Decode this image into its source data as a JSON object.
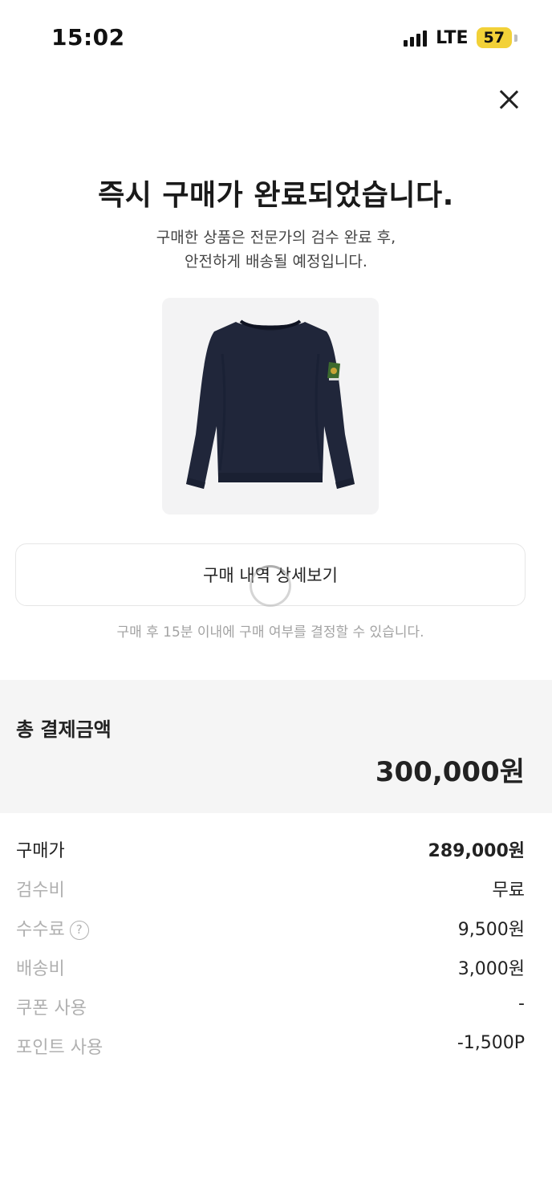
{
  "status_bar": {
    "time": "15:02",
    "network": "LTE",
    "battery": "57",
    "battery_color": "#f2d138"
  },
  "header": {
    "close_icon": "close-icon"
  },
  "main": {
    "title": "즉시 구매가 완료되었습니다.",
    "subtitle_line1": "구매한 상품은 전문가의 검수 완료 후,",
    "subtitle_line2": "안전하게 배송될 예정입니다.",
    "product_image": "navy-sweatshirt",
    "detail_button_label": "구매 내역 상세보기",
    "notice": "구매 후 15분 이내에 구매 여부를 결정할 수 있습니다."
  },
  "total": {
    "label": "총 결제금액",
    "amount": "300,000원"
  },
  "breakdown": [
    {
      "label": "구매가",
      "value": "289,000원"
    },
    {
      "label": "검수비",
      "value": "무료"
    },
    {
      "label": "수수료",
      "value": "9,500원",
      "help": "?"
    },
    {
      "label": "배송비",
      "value": "3,000원"
    },
    {
      "label": "쿠폰 사용",
      "value": "-"
    },
    {
      "label": "포인트 사용",
      "value": "-1,500P"
    }
  ]
}
